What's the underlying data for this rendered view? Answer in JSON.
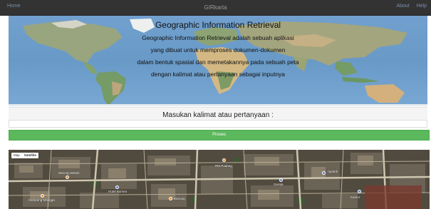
{
  "navbar": {
    "title": "GIRkarta",
    "left_link": "Home",
    "right_links": [
      "About",
      "Help"
    ]
  },
  "hero": {
    "title": "Geographic Information Retrieval",
    "lines": [
      "Geographic Information Retrieval adalah sebuah aplikasi",
      "yang dibuat untuk memproses dokumen-dokumen",
      "dalam bentuk spasial dan memetakannya pada sebuah peta",
      "dengan kalimat atau pertanyaan sebagai inputnya"
    ]
  },
  "query": {
    "label": "Masukan kalimat atau pertanyaan :",
    "value": "",
    "placeholder": "",
    "button_label": "Proses",
    "button_color": "#5cb85c"
  },
  "map": {
    "type_options": [
      "Map",
      "Satellite"
    ],
    "selected_type": "Satellite",
    "places": [
      {
        "label": "Warung Bebek"
      },
      {
        "label": "Hotel Borneo"
      },
      {
        "label": "Kampung Manggis"
      },
      {
        "label": "RM Padang"
      },
      {
        "label": "Gereja"
      },
      {
        "label": "Apotek"
      },
      {
        "label": "Kantor"
      },
      {
        "label": "Warung"
      }
    ]
  }
}
